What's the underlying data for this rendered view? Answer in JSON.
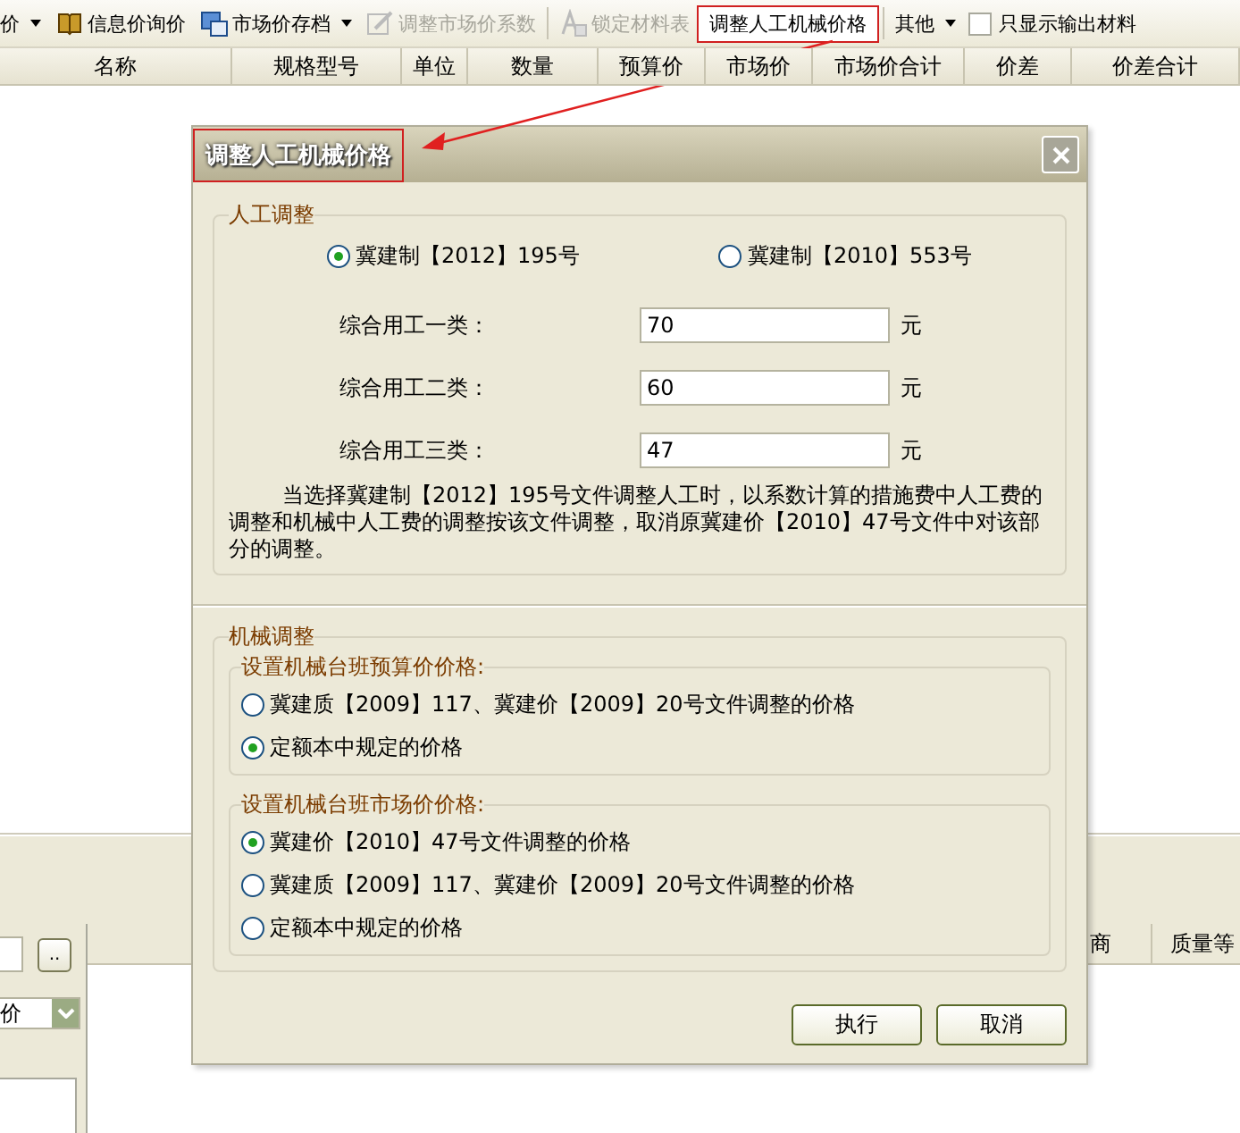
{
  "toolbar": [
    {
      "label": "价",
      "kind": "menu",
      "disabled": false,
      "highlighted": false
    },
    {
      "label": "信息价询价",
      "kind": "button",
      "disabled": false,
      "highlighted": false
    },
    {
      "label": "市场价存档",
      "kind": "menu",
      "disabled": false,
      "highlighted": false
    },
    {
      "label": "调整市场价系数",
      "kind": "button",
      "disabled": true,
      "highlighted": false
    },
    {
      "label": "锁定材料表",
      "kind": "button",
      "disabled": true,
      "highlighted": false
    },
    {
      "label": "调整人工机械价格",
      "kind": "button",
      "disabled": false,
      "highlighted": true
    },
    {
      "label": "其他",
      "kind": "menu",
      "disabled": false,
      "highlighted": false
    },
    {
      "label": "只显示输出材料",
      "kind": "checkbox",
      "checked": false
    }
  ],
  "table": {
    "columns": [
      "名称",
      "规格型号",
      "单位",
      "数量",
      "预算价",
      "市场价",
      "市场价合计",
      "价差",
      "价差合计"
    ]
  },
  "lower_panel": {
    "browse_button": "..",
    "dropdown": {
      "value": "价"
    },
    "columns": [
      "商",
      "质量等"
    ]
  },
  "dialog": {
    "title": "调整人工机械价格",
    "title_highlighted": true,
    "labor": {
      "title": "人工调整",
      "options": [
        {
          "label": "冀建制【2012】195号",
          "selected": true
        },
        {
          "label": "冀建制【2010】553号",
          "selected": false
        }
      ],
      "rates": [
        {
          "label": "综合用工一类：",
          "value": "70",
          "unit": "元"
        },
        {
          "label": "综合用工二类：",
          "value": "60",
          "unit": "元"
        },
        {
          "label": "综合用工三类：",
          "value": "47",
          "unit": "元"
        }
      ],
      "note": "当选择冀建制【2012】195号文件调整人工时，以系数计算的措施费中人工费的调整和机械中人工费的调整按该文件调整，取消原冀建价【2010】47号文件中对该部分的调整。"
    },
    "machine": {
      "title": "机械调整",
      "groups": [
        {
          "title": "设置机械台班预算价价格:",
          "options": [
            {
              "label": "冀建质【2009】117、冀建价【2009】20号文件调整的价格",
              "selected": false
            },
            {
              "label": "定额本中规定的价格",
              "selected": true
            }
          ]
        },
        {
          "title": "设置机械台班市场价价格:",
          "options": [
            {
              "label": "冀建价【2010】47号文件调整的价格",
              "selected": true
            },
            {
              "label": "冀建质【2009】117、冀建价【2009】20号文件调整的价格",
              "selected": false
            },
            {
              "label": "定额本中规定的价格",
              "selected": false
            }
          ]
        }
      ]
    },
    "buttons": [
      "执行",
      "取消"
    ]
  }
}
